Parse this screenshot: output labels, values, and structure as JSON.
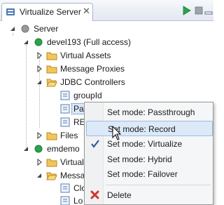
{
  "view": {
    "tab_title": "Virtualize Server",
    "tab_close": "✕",
    "toolbar_icons": [
      "run-icon",
      "stop-icon",
      "minimize-icon",
      "maximize-icon"
    ]
  },
  "tree": {
    "server": "Server",
    "devel": "devel193 (Full access)",
    "virtual_assets": "Virtual Assets",
    "message_proxies": "Message Proxies",
    "jdbc_controllers": "JDBC Controllers",
    "groupid": "groupId",
    "parabank": "ParaBank2",
    "re": "RE",
    "files": "Files",
    "emdemo": "emdemo",
    "virtual_partial": "Virtual",
    "messa_partial": "Messa",
    "clo_partial": "Clo",
    "lo1_partial": "Lo",
    "lo2_partial": "Lo"
  },
  "context_menu": {
    "items": [
      "Set mode: Passthrough",
      "Set mode: Record",
      "Set mode: Virtualize",
      "Set mode: Hybrid",
      "Set mode: Failover",
      "Delete"
    ],
    "checked_index": 2,
    "hover_index": 1
  }
}
